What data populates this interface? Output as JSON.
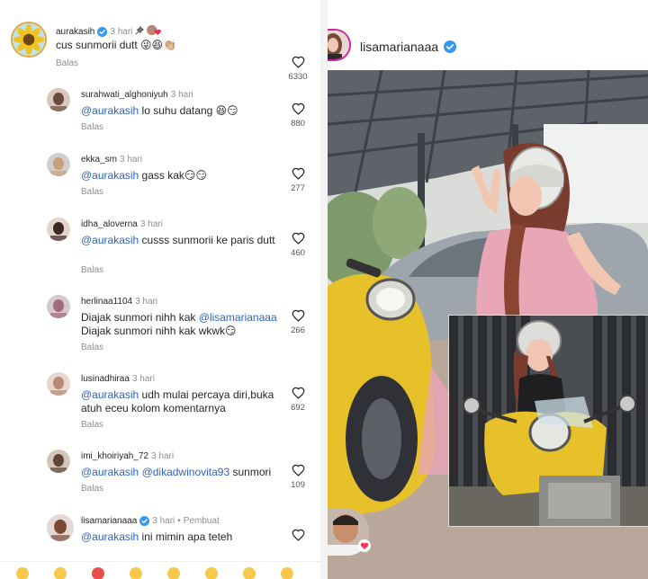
{
  "comments": [
    {
      "username": "aurakasih",
      "verified": true,
      "time": "3 hari",
      "pinned": true,
      "creator_liked": true,
      "parts": [
        {
          "text": "cus sunmorii dutt 😜😆👏🏼",
          "mention": false
        }
      ],
      "reply_label": "Balas",
      "likes": "6330",
      "avatar_icon": "sunflower-avatar"
    },
    {
      "username": "surahwati_alghoniyuh",
      "time": "3 hari",
      "parts": [
        {
          "text": "@aurakasih",
          "mention": true
        },
        {
          "text": " lo suhu datang 😆😏",
          "mention": false
        }
      ],
      "reply_label": "Balas",
      "likes": "880"
    },
    {
      "username": "ekka_sm",
      "time": "3 hari",
      "parts": [
        {
          "text": "@aurakasih",
          "mention": true
        },
        {
          "text": " gass kak😏😏",
          "mention": false
        }
      ],
      "reply_label": "Balas",
      "likes": "277"
    },
    {
      "username": "idha_aloverna",
      "time": "3 hari",
      "parts": [
        {
          "text": "@aurakasih",
          "mention": true
        },
        {
          "text": " cusss sunmorii ke paris dutt",
          "mention": false
        }
      ],
      "reply_label": "Balas",
      "likes": "460"
    },
    {
      "username": "herlinaa1104",
      "time": "3 hari",
      "parts": [
        {
          "text": "Diajak sunmori nihh kak ",
          "mention": false
        },
        {
          "text": "@lisamarianaaa",
          "mention": true
        },
        {
          "text": " Diajak sunmori nihh kak wkwk😏",
          "mention": false
        }
      ],
      "reply_label": "Balas",
      "likes": "266"
    },
    {
      "username": "lusinadhiraa",
      "time": "3 hari",
      "parts": [
        {
          "text": "@aurakasih",
          "mention": true
        },
        {
          "text": " udh mulai percaya diri,buka atuh eceu kolom komentarnya",
          "mention": false
        }
      ],
      "reply_label": "Balas",
      "likes": "692"
    },
    {
      "username": "imi_khoiriyah_72",
      "time": "3 hari",
      "parts": [
        {
          "text": "@aurakasih",
          "mention": true
        },
        {
          "text": " ",
          "mention": false
        },
        {
          "text": "@dikadwinovita93",
          "mention": true
        },
        {
          "text": " sunmori",
          "mention": false
        }
      ],
      "reply_label": "Balas",
      "likes": "109"
    },
    {
      "username": "lisamarianaaa",
      "verified": true,
      "time": "3 hari",
      "author_badge": "Pembuat",
      "parts": [
        {
          "text": "@aurakasih",
          "mention": true
        },
        {
          "text": " ini mimin apa teteh",
          "mention": false
        }
      ],
      "reply_label": "",
      "likes": ""
    }
  ],
  "post": {
    "username": "lisamarianaaa",
    "verified": true
  },
  "colors": {
    "mention": "#2c64c8",
    "verified": "#3897f0",
    "like_heart": "#262626",
    "scooter_yellow": "#e6c12a",
    "shirt_pink": "#e9a6b7",
    "canopy": "#5a5f66"
  },
  "icons": {
    "like": "heart-outline-icon",
    "verified": "verified-badge-icon",
    "pinned": "pin-icon",
    "creator_liked": "creator-heart-icon"
  }
}
